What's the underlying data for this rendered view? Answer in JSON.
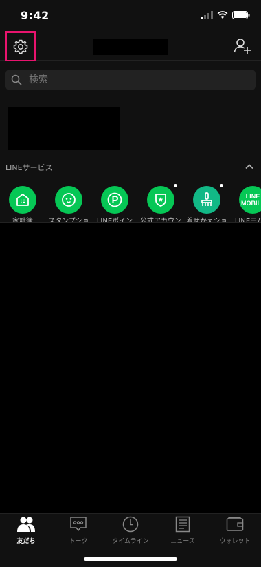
{
  "status_bar": {
    "time": "9:42"
  },
  "header": {
    "settings_icon": "gear-icon",
    "add_friend_icon": "add-friend-icon"
  },
  "search": {
    "placeholder": "検索"
  },
  "services": {
    "section_title": "LINEサービス",
    "items": [
      {
        "label": "家計簿",
        "icon": "household-icon",
        "badge": false
      },
      {
        "label": "スタンプショップ",
        "icon": "sticker-icon",
        "badge": false
      },
      {
        "label": "LINEポイント",
        "icon": "points-icon",
        "badge": false
      },
      {
        "label": "公式アカウント",
        "icon": "official-account-icon",
        "badge": true
      },
      {
        "label": "着せかえショップ",
        "icon": "theme-icon",
        "badge": true
      },
      {
        "label": "LINEモバイル",
        "icon": "line-mobile-icon",
        "badge": false,
        "icon_text": "LINE MOBILE"
      }
    ]
  },
  "tabs": [
    {
      "label": "友だち",
      "icon": "friends-icon",
      "active": true
    },
    {
      "label": "トーク",
      "icon": "chat-icon",
      "active": false
    },
    {
      "label": "タイムライン",
      "icon": "timeline-icon",
      "active": false
    },
    {
      "label": "ニュース",
      "icon": "news-icon",
      "active": false
    },
    {
      "label": "ウォレット",
      "icon": "wallet-icon",
      "active": false
    }
  ],
  "colors": {
    "accent": "#06c755",
    "highlight": "#e8146e",
    "background": "#111111"
  }
}
